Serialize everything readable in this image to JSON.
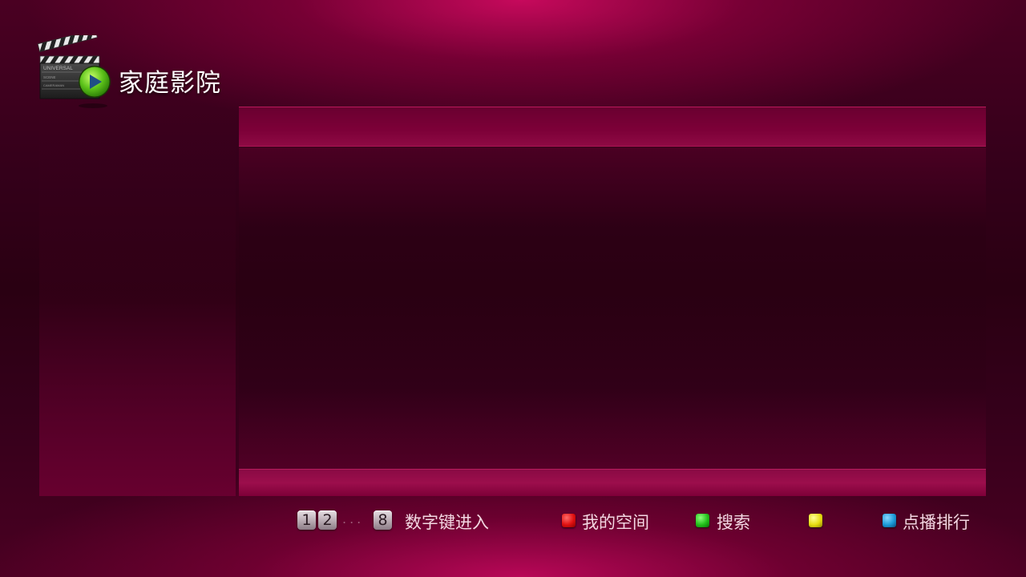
{
  "app": {
    "title": "家庭影院",
    "logo_lettering": [
      "UNIVERSAL",
      "SCENE",
      "CAMERAMAN"
    ]
  },
  "footer": {
    "number_keys": [
      "1",
      "2",
      "8"
    ],
    "ellipsis": "...",
    "number_hint": "数字键进入",
    "color_keys": [
      {
        "color": "#e01010",
        "icon": "red-key-icon",
        "label": "我的空间"
      },
      {
        "color": "#22c01a",
        "icon": "green-key-icon",
        "label": "搜索"
      },
      {
        "color": "#e6dc10",
        "icon": "yellow-key-icon",
        "label": ""
      },
      {
        "color": "#1a9ad8",
        "icon": "blue-key-icon",
        "label": "点播排行"
      }
    ]
  },
  "theme": {
    "accent": "#c8085a",
    "background": "#2a0012"
  }
}
